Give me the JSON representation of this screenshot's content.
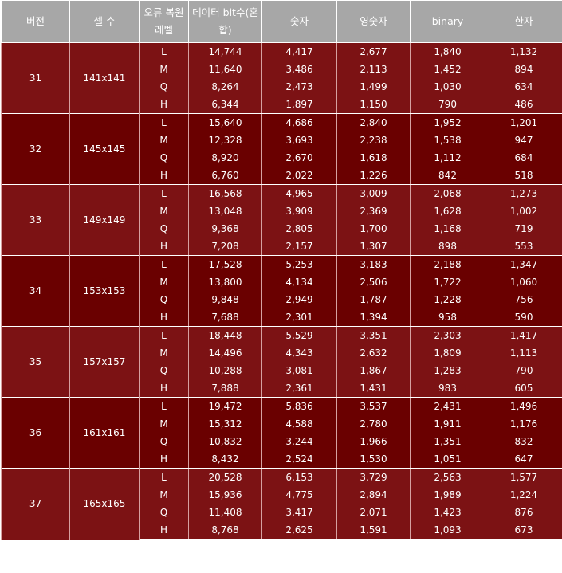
{
  "headers": [
    "버전",
    "셀 수",
    "오류 복원 레벨",
    "데이터 bit수(혼합)",
    "숫자",
    "영숫자",
    "binary",
    "한자"
  ],
  "versions": [
    {
      "version": "31",
      "cells": "141x141",
      "rows": [
        {
          "level": "L",
          "data_bits": "14,744",
          "numeric": "4,417",
          "alphanumeric": "2,677",
          "binary": "1,840",
          "kanji": "1,132"
        },
        {
          "level": "M",
          "data_bits": "11,640",
          "numeric": "3,486",
          "alphanumeric": "2,113",
          "binary": "1,452",
          "kanji": "894"
        },
        {
          "level": "Q",
          "data_bits": "8,264",
          "numeric": "2,473",
          "alphanumeric": "1,499",
          "binary": "1,030",
          "kanji": "634"
        },
        {
          "level": "H",
          "data_bits": "6,344",
          "numeric": "1,897",
          "alphanumeric": "1,150",
          "binary": "790",
          "kanji": "486"
        }
      ]
    },
    {
      "version": "32",
      "cells": "145x145",
      "rows": [
        {
          "level": "L",
          "data_bits": "15,640",
          "numeric": "4,686",
          "alphanumeric": "2,840",
          "binary": "1,952",
          "kanji": "1,201"
        },
        {
          "level": "M",
          "data_bits": "12,328",
          "numeric": "3,693",
          "alphanumeric": "2,238",
          "binary": "1,538",
          "kanji": "947"
        },
        {
          "level": "Q",
          "data_bits": "8,920",
          "numeric": "2,670",
          "alphanumeric": "1,618",
          "binary": "1,112",
          "kanji": "684"
        },
        {
          "level": "H",
          "data_bits": "6,760",
          "numeric": "2,022",
          "alphanumeric": "1,226",
          "binary": "842",
          "kanji": "518"
        }
      ]
    },
    {
      "version": "33",
      "cells": "149x149",
      "rows": [
        {
          "level": "L",
          "data_bits": "16,568",
          "numeric": "4,965",
          "alphanumeric": "3,009",
          "binary": "2,068",
          "kanji": "1,273"
        },
        {
          "level": "M",
          "data_bits": "13,048",
          "numeric": "3,909",
          "alphanumeric": "2,369",
          "binary": "1,628",
          "kanji": "1,002"
        },
        {
          "level": "Q",
          "data_bits": "9,368",
          "numeric": "2,805",
          "alphanumeric": "1,700",
          "binary": "1,168",
          "kanji": "719"
        },
        {
          "level": "H",
          "data_bits": "7,208",
          "numeric": "2,157",
          "alphanumeric": "1,307",
          "binary": "898",
          "kanji": "553"
        }
      ]
    },
    {
      "version": "34",
      "cells": "153x153",
      "rows": [
        {
          "level": "L",
          "data_bits": "17,528",
          "numeric": "5,253",
          "alphanumeric": "3,183",
          "binary": "2,188",
          "kanji": "1,347"
        },
        {
          "level": "M",
          "data_bits": "13,800",
          "numeric": "4,134",
          "alphanumeric": "2,506",
          "binary": "1,722",
          "kanji": "1,060"
        },
        {
          "level": "Q",
          "data_bits": "9,848",
          "numeric": "2,949",
          "alphanumeric": "1,787",
          "binary": "1,228",
          "kanji": "756"
        },
        {
          "level": "H",
          "data_bits": "7,688",
          "numeric": "2,301",
          "alphanumeric": "1,394",
          "binary": "958",
          "kanji": "590"
        }
      ]
    },
    {
      "version": "35",
      "cells": "157x157",
      "rows": [
        {
          "level": "L",
          "data_bits": "18,448",
          "numeric": "5,529",
          "alphanumeric": "3,351",
          "binary": "2,303",
          "kanji": "1,417"
        },
        {
          "level": "M",
          "data_bits": "14,496",
          "numeric": "4,343",
          "alphanumeric": "2,632",
          "binary": "1,809",
          "kanji": "1,113"
        },
        {
          "level": "Q",
          "data_bits": "10,288",
          "numeric": "3,081",
          "alphanumeric": "1,867",
          "binary": "1,283",
          "kanji": "790"
        },
        {
          "level": "H",
          "data_bits": "7,888",
          "numeric": "2,361",
          "alphanumeric": "1,431",
          "binary": "983",
          "kanji": "605"
        }
      ]
    },
    {
      "version": "36",
      "cells": "161x161",
      "rows": [
        {
          "level": "L",
          "data_bits": "19,472",
          "numeric": "5,836",
          "alphanumeric": "3,537",
          "binary": "2,431",
          "kanji": "1,496"
        },
        {
          "level": "M",
          "data_bits": "15,312",
          "numeric": "4,588",
          "alphanumeric": "2,780",
          "binary": "1,911",
          "kanji": "1,176"
        },
        {
          "level": "Q",
          "data_bits": "10,832",
          "numeric": "3,244",
          "alphanumeric": "1,966",
          "binary": "1,351",
          "kanji": "832"
        },
        {
          "level": "H",
          "data_bits": "8,432",
          "numeric": "2,524",
          "alphanumeric": "1,530",
          "binary": "1,051",
          "kanji": "647"
        }
      ]
    },
    {
      "version": "37",
      "cells": "165x165",
      "rows": [
        {
          "level": "L",
          "data_bits": "20,528",
          "numeric": "6,153",
          "alphanumeric": "3,729",
          "binary": "2,563",
          "kanji": "1,577"
        },
        {
          "level": "M",
          "data_bits": "15,936",
          "numeric": "4,775",
          "alphanumeric": "2,894",
          "binary": "1,989",
          "kanji": "1,224"
        },
        {
          "level": "Q",
          "data_bits": "11,408",
          "numeric": "3,417",
          "alphanumeric": "2,071",
          "binary": "1,423",
          "kanji": "876"
        },
        {
          "level": "H",
          "data_bits": "8,768",
          "numeric": "2,625",
          "alphanumeric": "1,591",
          "binary": "1,093",
          "kanji": "673"
        }
      ]
    }
  ],
  "colors": {
    "header_bg": "#a7a7a7",
    "row_odd": "#7c1214",
    "row_even": "#6a0000",
    "text": "#ffffff"
  }
}
